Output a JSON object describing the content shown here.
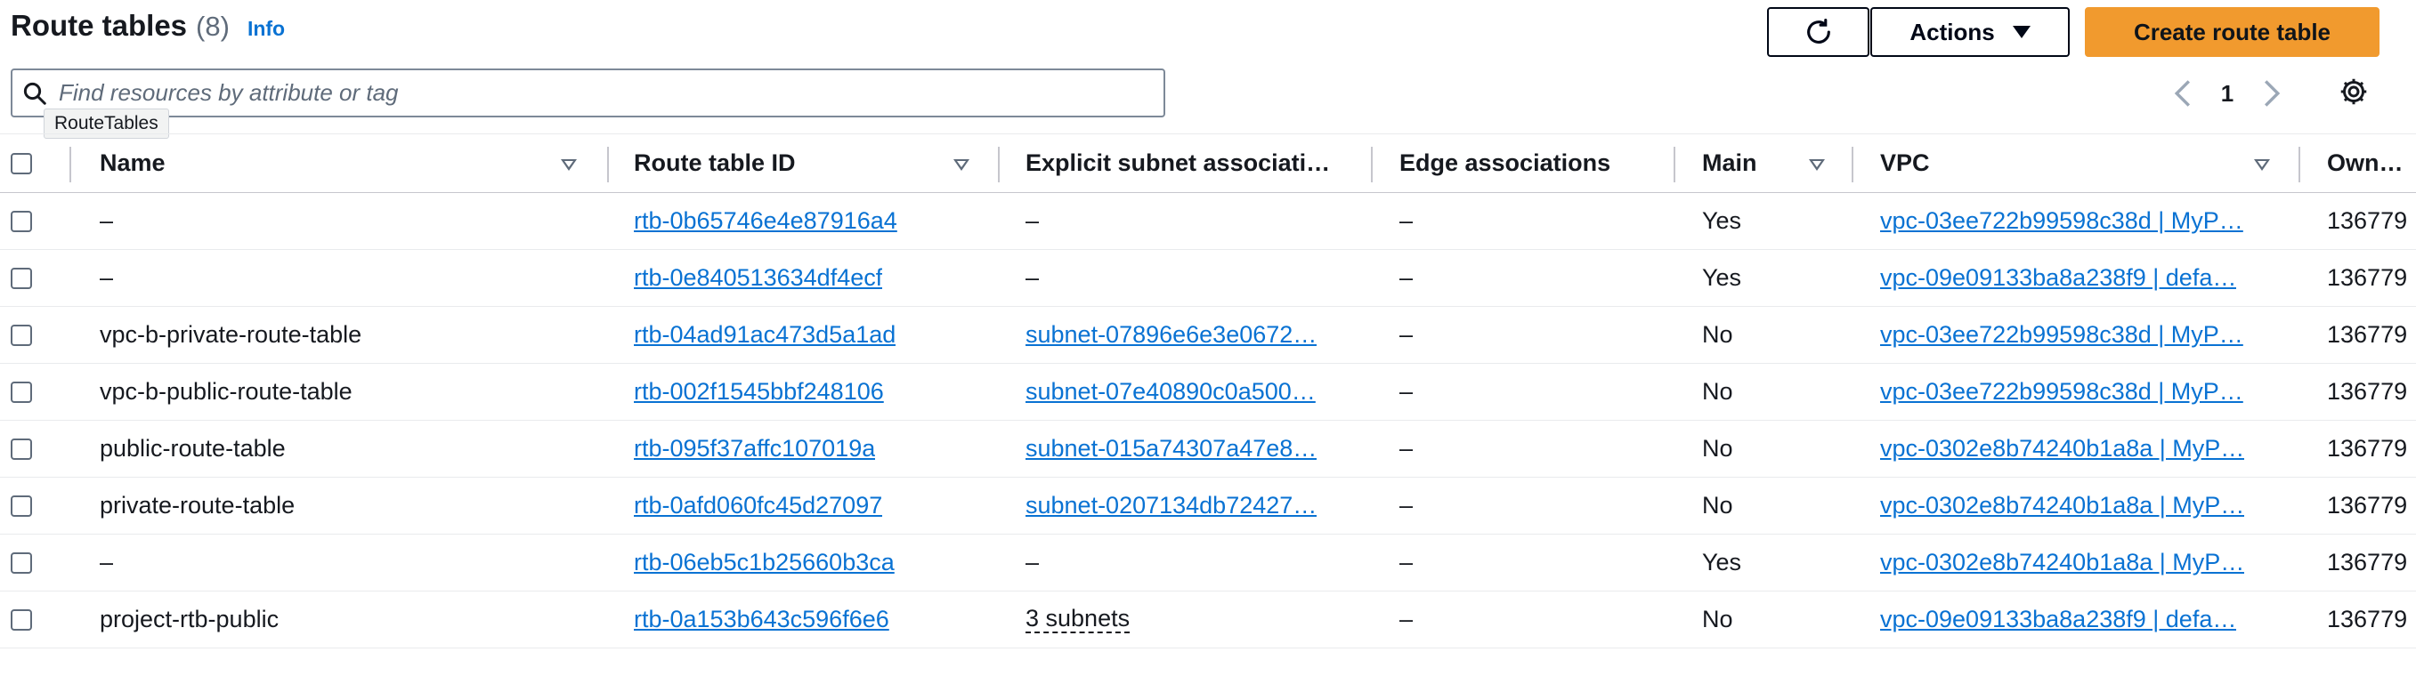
{
  "header": {
    "title": "Route tables",
    "count": "(8)",
    "info": "Info",
    "actions_label": "Actions",
    "create_label": "Create route table"
  },
  "search": {
    "placeholder": "Find resources by attribute or tag",
    "tooltip": "RouteTables"
  },
  "pagination": {
    "current_page": "1"
  },
  "table": {
    "columns": {
      "name": "Name",
      "route_table_id": "Route table ID",
      "explicit_subnet": "Explicit subnet associati…",
      "edge": "Edge associations",
      "main": "Main",
      "vpc": "VPC",
      "owner": "Own…"
    },
    "rows": [
      {
        "name": "–",
        "rtb": "rtb-0b65746e4e87916a4",
        "subnet": "–",
        "subnet_link": false,
        "edge": "–",
        "main": "Yes",
        "vpc": "vpc-03ee722b99598c38d | MyP…",
        "owner": "136779"
      },
      {
        "name": "–",
        "rtb": "rtb-0e840513634df4ecf",
        "subnet": "–",
        "subnet_link": false,
        "edge": "–",
        "main": "Yes",
        "vpc": "vpc-09e09133ba8a238f9 | defa…",
        "owner": "136779"
      },
      {
        "name": "vpc-b-private-route-table",
        "rtb": "rtb-04ad91ac473d5a1ad",
        "subnet": "subnet-07896e6e3e0672…",
        "subnet_link": true,
        "edge": "–",
        "main": "No",
        "vpc": "vpc-03ee722b99598c38d | MyP…",
        "owner": "136779"
      },
      {
        "name": "vpc-b-public-route-table",
        "rtb": "rtb-002f1545bbf248106",
        "subnet": "subnet-07e40890c0a500…",
        "subnet_link": true,
        "edge": "–",
        "main": "No",
        "vpc": "vpc-03ee722b99598c38d | MyP…",
        "owner": "136779"
      },
      {
        "name": "public-route-table",
        "rtb": "rtb-095f37affc107019a",
        "subnet": "subnet-015a74307a47e8…",
        "subnet_link": true,
        "edge": "–",
        "main": "No",
        "vpc": "vpc-0302e8b74240b1a8a | MyP…",
        "owner": "136779"
      },
      {
        "name": "private-route-table",
        "rtb": "rtb-0afd060fc45d27097",
        "subnet": "subnet-0207134db72427…",
        "subnet_link": true,
        "edge": "–",
        "main": "No",
        "vpc": "vpc-0302e8b74240b1a8a | MyP…",
        "owner": "136779"
      },
      {
        "name": "–",
        "rtb": "rtb-06eb5c1b25660b3ca",
        "subnet": "–",
        "subnet_link": false,
        "edge": "–",
        "main": "Yes",
        "vpc": "vpc-0302e8b74240b1a8a | MyP…",
        "owner": "136779"
      },
      {
        "name": "project-rtb-public",
        "rtb": "rtb-0a153b643c596f6e6",
        "subnet": "3 subnets",
        "subnet_link": "dashed",
        "edge": "–",
        "main": "No",
        "vpc": "vpc-09e09133ba8a238f9 | defa…",
        "owner": "136779"
      }
    ]
  }
}
